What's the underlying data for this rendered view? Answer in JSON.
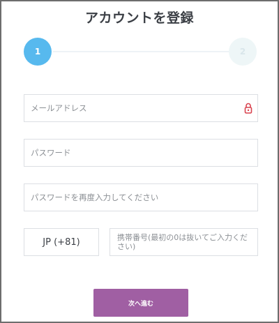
{
  "page": {
    "title": "アカウントを登録"
  },
  "stepper": {
    "steps": [
      {
        "label": "1",
        "active": true
      },
      {
        "label": "2",
        "active": false
      }
    ],
    "active_color": "#57b9ee",
    "inactive_color": "#eef6f7"
  },
  "form": {
    "email": {
      "placeholder": "メールアドレス",
      "value": "",
      "icon": "lock-icon"
    },
    "password": {
      "placeholder": "パスワード",
      "value": ""
    },
    "password_confirm": {
      "placeholder": "パスワードを再度入力してください",
      "value": ""
    },
    "country_code": {
      "value": "JP (+81)"
    },
    "phone": {
      "placeholder": "携帯番号(最初の0は抜いてご入力ください)",
      "value": ""
    }
  },
  "actions": {
    "next_label": "次へ進む",
    "next_color": "#a05fa3"
  }
}
